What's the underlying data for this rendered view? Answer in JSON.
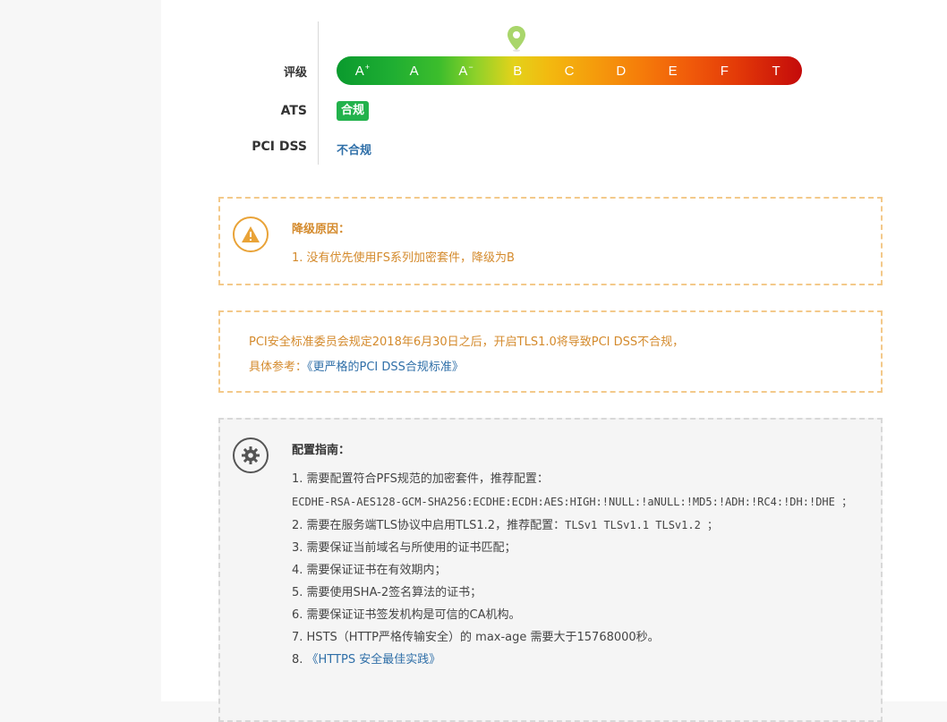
{
  "rating": {
    "label": "评级",
    "grades": [
      {
        "letter": "A",
        "mod": "+"
      },
      {
        "letter": "A",
        "mod": ""
      },
      {
        "letter": "A",
        "mod": "−"
      },
      {
        "letter": "B",
        "mod": ""
      },
      {
        "letter": "C",
        "mod": ""
      },
      {
        "letter": "D",
        "mod": ""
      },
      {
        "letter": "E",
        "mod": ""
      },
      {
        "letter": "F",
        "mod": ""
      },
      {
        "letter": "T",
        "mod": ""
      }
    ],
    "current_grade": "B",
    "pin_icon": "location-pin-icon"
  },
  "ats": {
    "label": "ATS",
    "status": "合规",
    "color": "#22b24c"
  },
  "pci": {
    "label": "PCI DSS",
    "status": "不合规",
    "color": "#2f6fa8"
  },
  "downgrade": {
    "icon": "warning-icon",
    "title": "降级原因：",
    "items": [
      "1. 没有优先使用FS系列加密套件，降级为B"
    ]
  },
  "pci_notice": {
    "line1": "PCI安全标准委员会规定2018年6月30日之后，开启TLS1.0将导致PCI DSS不合规，",
    "ref_prefix": "具体参考：",
    "ref_link": "《更严格的PCI DSS合规标准》"
  },
  "guide": {
    "icon": "gear-icon",
    "title": "配置指南：",
    "item1": "1. 需要配置符合PFS规范的加密套件，推荐配置：",
    "cipher": "ECDHE-RSA-AES128-GCM-SHA256:ECDHE:ECDH:AES:HIGH:!NULL:!aNULL:!MD5:!ADH:!RC4:!DH:!DHE ；",
    "item2_prefix": "2. 需要在服务端TLS协议中启用TLS1.2，推荐配置：",
    "item2_code": "TLSv1 TLSv1.1 TLSv1.2 ；",
    "item3": "3. 需要保证当前域名与所使用的证书匹配；",
    "item4": "4. 需要保证证书在有效期内；",
    "item5": "5. 需要使用SHA-2签名算法的证书；",
    "item6": "6. 需要保证证书签发机构是可信的CA机构。",
    "item7": "7. HSTS（HTTP严格传输安全）的 max-age 需要大于15768000秒。",
    "item8_prefix": "8. ",
    "item8_link": "《HTTPS 安全最佳实践》"
  }
}
